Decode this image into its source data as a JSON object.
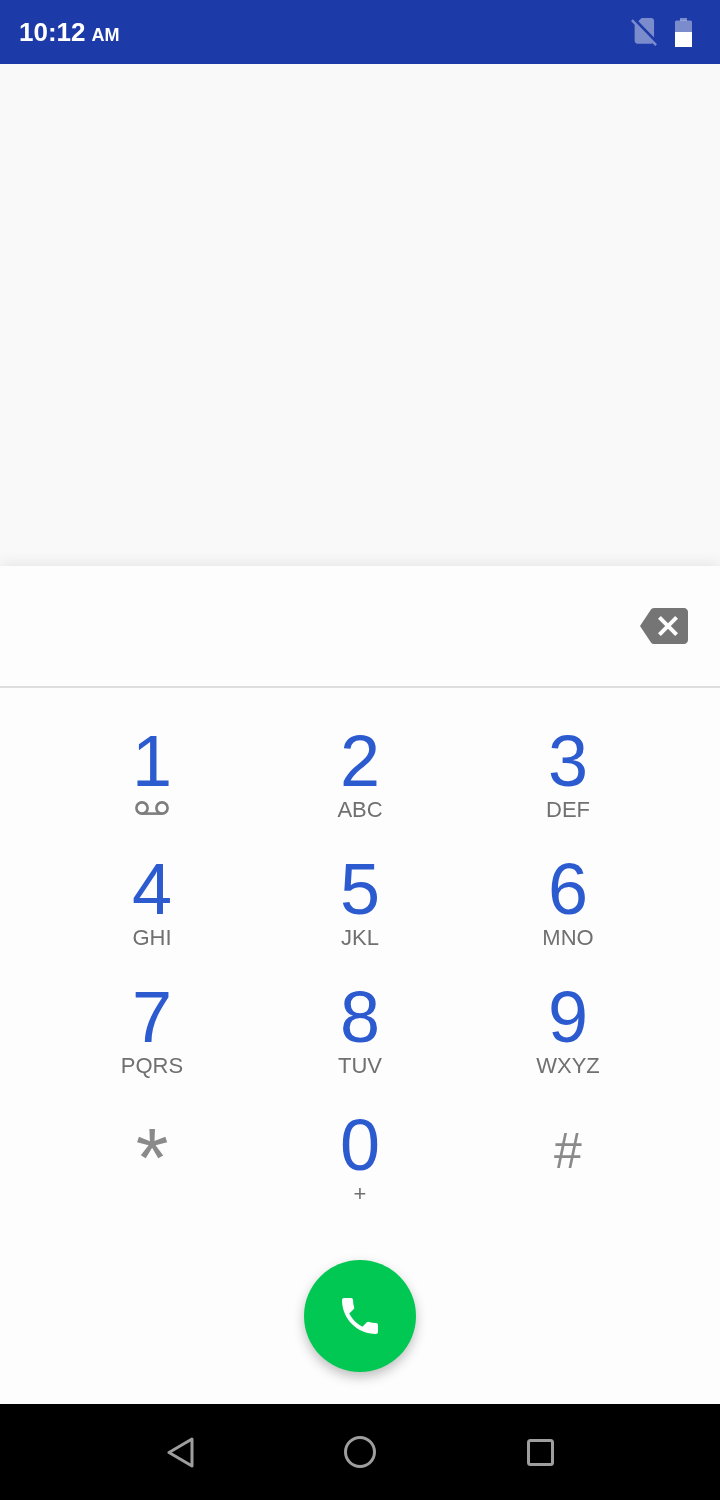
{
  "status_bar": {
    "time": "10:12",
    "period": "AM"
  },
  "dialpad": {
    "keys": [
      {
        "kind": "voicemail",
        "digit": "1"
      },
      {
        "kind": "letters",
        "digit": "2",
        "letters": "ABC"
      },
      {
        "kind": "letters",
        "digit": "3",
        "letters": "DEF"
      },
      {
        "kind": "letters",
        "digit": "4",
        "letters": "GHI"
      },
      {
        "kind": "letters",
        "digit": "5",
        "letters": "JKL"
      },
      {
        "kind": "letters",
        "digit": "6",
        "letters": "MNO"
      },
      {
        "kind": "letters",
        "digit": "7",
        "letters": "PQRS"
      },
      {
        "kind": "letters",
        "digit": "8",
        "letters": "TUV"
      },
      {
        "kind": "letters",
        "digit": "9",
        "letters": "WXYZ"
      },
      {
        "kind": "star",
        "digit": "*"
      },
      {
        "kind": "letters",
        "digit": "0",
        "letters": "+"
      },
      {
        "kind": "hash",
        "digit": "#"
      }
    ]
  }
}
